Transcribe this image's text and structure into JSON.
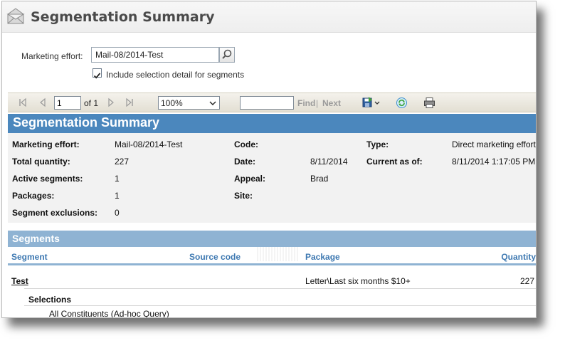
{
  "window": {
    "title": "Segmentation Summary"
  },
  "parameters": {
    "marketing_effort_label": "Marketing effort:",
    "marketing_effort_value": "Mail-08/2014-Test",
    "include_detail_label": "Include selection detail for segments",
    "include_detail_checked": true
  },
  "toolbar": {
    "page_number": "1",
    "page_of": "of 1",
    "zoom": "100%",
    "find_label": "Find",
    "separator": "|",
    "next_label": "Next"
  },
  "report": {
    "title": "Segmentation Summary",
    "summary": {
      "marketing_effort_label": "Marketing effort:",
      "marketing_effort_value": "Mail-08/2014-Test",
      "total_quantity_label": "Total quantity:",
      "total_quantity_value": "227",
      "active_segments_label": "Active segments:",
      "active_segments_value": "1",
      "packages_label": "Packages:",
      "packages_value": "1",
      "segment_exclusions_label": "Segment exclusions:",
      "segment_exclusions_value": "0",
      "code_label": "Code:",
      "code_value": "",
      "date_label": "Date:",
      "date_value": "8/11/2014",
      "appeal_label": "Appeal:",
      "appeal_value": "Brad",
      "site_label": "Site:",
      "site_value": "",
      "type_label": "Type:",
      "type_value": "Direct marketing effort",
      "current_as_of_label": "Current as of:",
      "current_as_of_value": "8/11/2014 1:17:05 PM"
    },
    "segments": {
      "title": "Segments",
      "columns": {
        "segment": "Segment",
        "source_code": "Source code",
        "package": "Package",
        "quantity": "Quantity"
      },
      "rows": [
        {
          "segment": "Test",
          "source_code": "",
          "package": "Letter\\Last six months $10+",
          "quantity": "227"
        }
      ],
      "selections_label": "Selections",
      "selections": [
        "All Constituents (Ad-hoc Query)"
      ]
    }
  },
  "colors": {
    "banner": "#4b87bd",
    "segments_bar": "#8fb3d3",
    "column_header_text": "#3d78b1",
    "summary_bg": "#f2f2f2"
  },
  "icons": {
    "window": "envelope-icon",
    "search": "search-icon",
    "first_page": "first-page-icon",
    "prev_page": "previous-page-icon",
    "next_page": "next-page-icon",
    "last_page": "last-page-icon",
    "export": "save-export-icon",
    "refresh": "refresh-icon",
    "print": "print-icon"
  }
}
